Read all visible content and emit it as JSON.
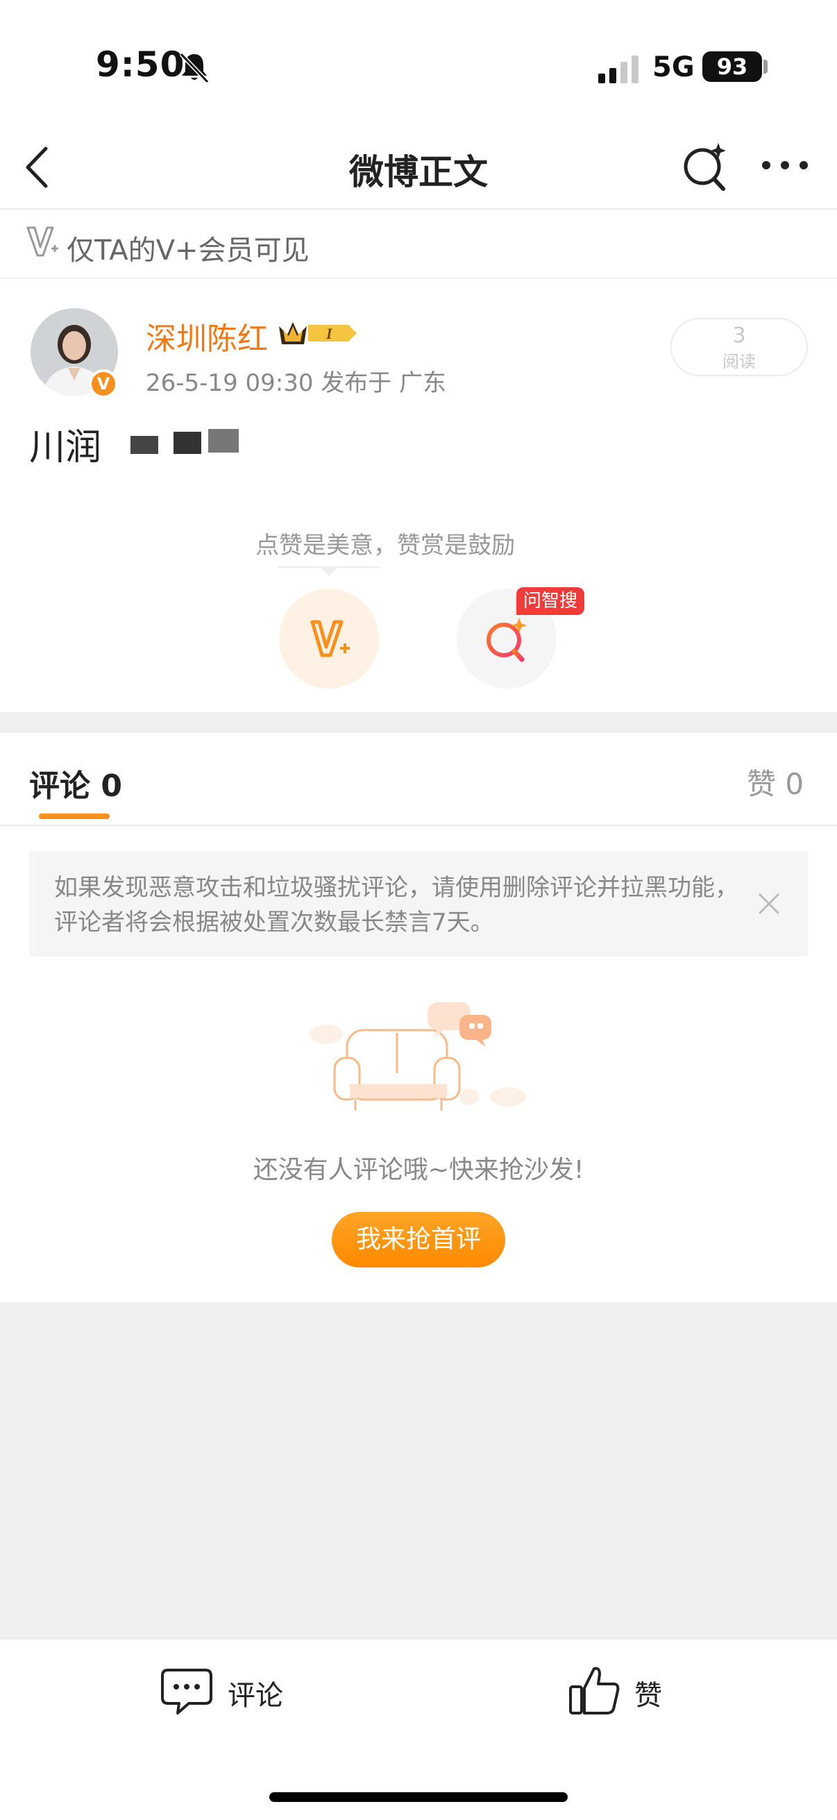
{
  "status_bar": {
    "time": "9:50",
    "network": "5G",
    "battery": "93"
  },
  "nav": {
    "title": "微博正文"
  },
  "vip_notice": {
    "text": "仅TA的V+会员可见"
  },
  "post": {
    "author": "深圳陈红",
    "meta": "26-5-19 09:30  发布于 广东",
    "read_count": "3",
    "read_label": "阅读",
    "text": "川润",
    "reward_tip": "点赞是美意，赞赏是鼓励",
    "wen_tag": "问智搜"
  },
  "tabs": {
    "comments": "评论 0",
    "likes": "赞 0"
  },
  "notice": {
    "text": "如果发现恶意攻击和垃圾骚扰评论，请使用删除评论并拉黑功能，评论者将会根据被处置次数最长禁言7天。"
  },
  "empty": {
    "text": "还没有人评论哦~快来抢沙发!",
    "button": "我来抢首评"
  },
  "bottom_bar": {
    "comment": "评论",
    "like": "赞"
  },
  "colors": {
    "accent_orange": "#f7901e",
    "username_orange": "#eb7a1a",
    "tag_red": "#ef3b3b"
  }
}
